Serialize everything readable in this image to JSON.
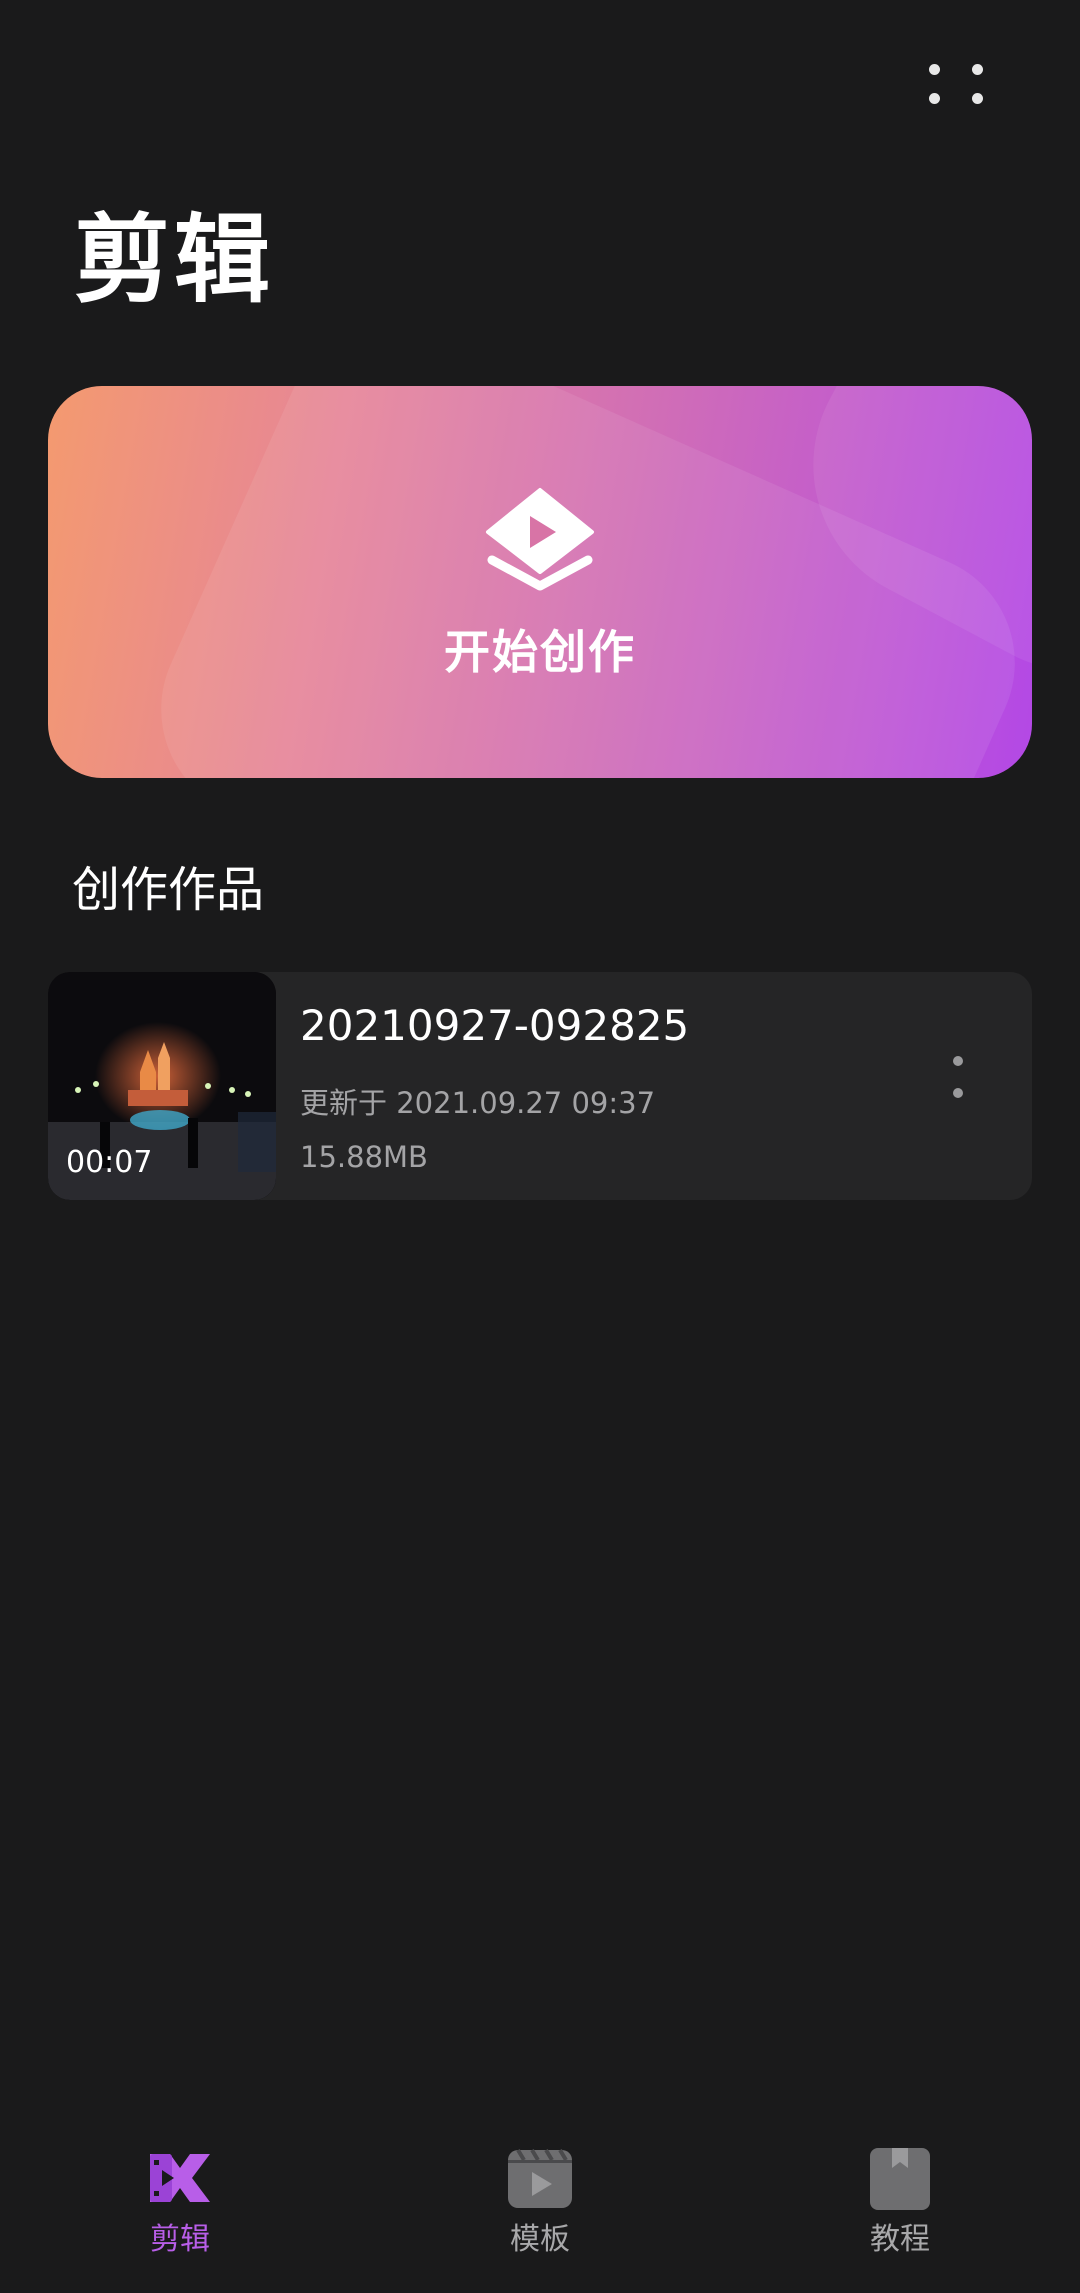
{
  "header": {
    "title": "剪辑",
    "more_icon": "more-dots-icon"
  },
  "create_card": {
    "label": "开始创作",
    "icon": "layers-play-icon",
    "gradient": [
      "#f49a6f",
      "#cf6cb8",
      "#b348e6"
    ]
  },
  "works": {
    "section_title": "创作作品",
    "items": [
      {
        "name": "20210927-092825",
        "updated": "更新于 2021.09.27 09:37",
        "size": "15.88MB",
        "duration": "00:07",
        "thumbnail": "night-castle-video-thumbnail"
      }
    ]
  },
  "tabbar": {
    "tabs": [
      {
        "label": "剪辑",
        "icon": "edit-film-icon",
        "active": true
      },
      {
        "label": "模板",
        "icon": "template-play-icon",
        "active": false
      },
      {
        "label": "教程",
        "icon": "tutorial-book-icon",
        "active": false
      }
    ],
    "active_color": "#b85ee8",
    "inactive_color": "#a8a8aa"
  }
}
